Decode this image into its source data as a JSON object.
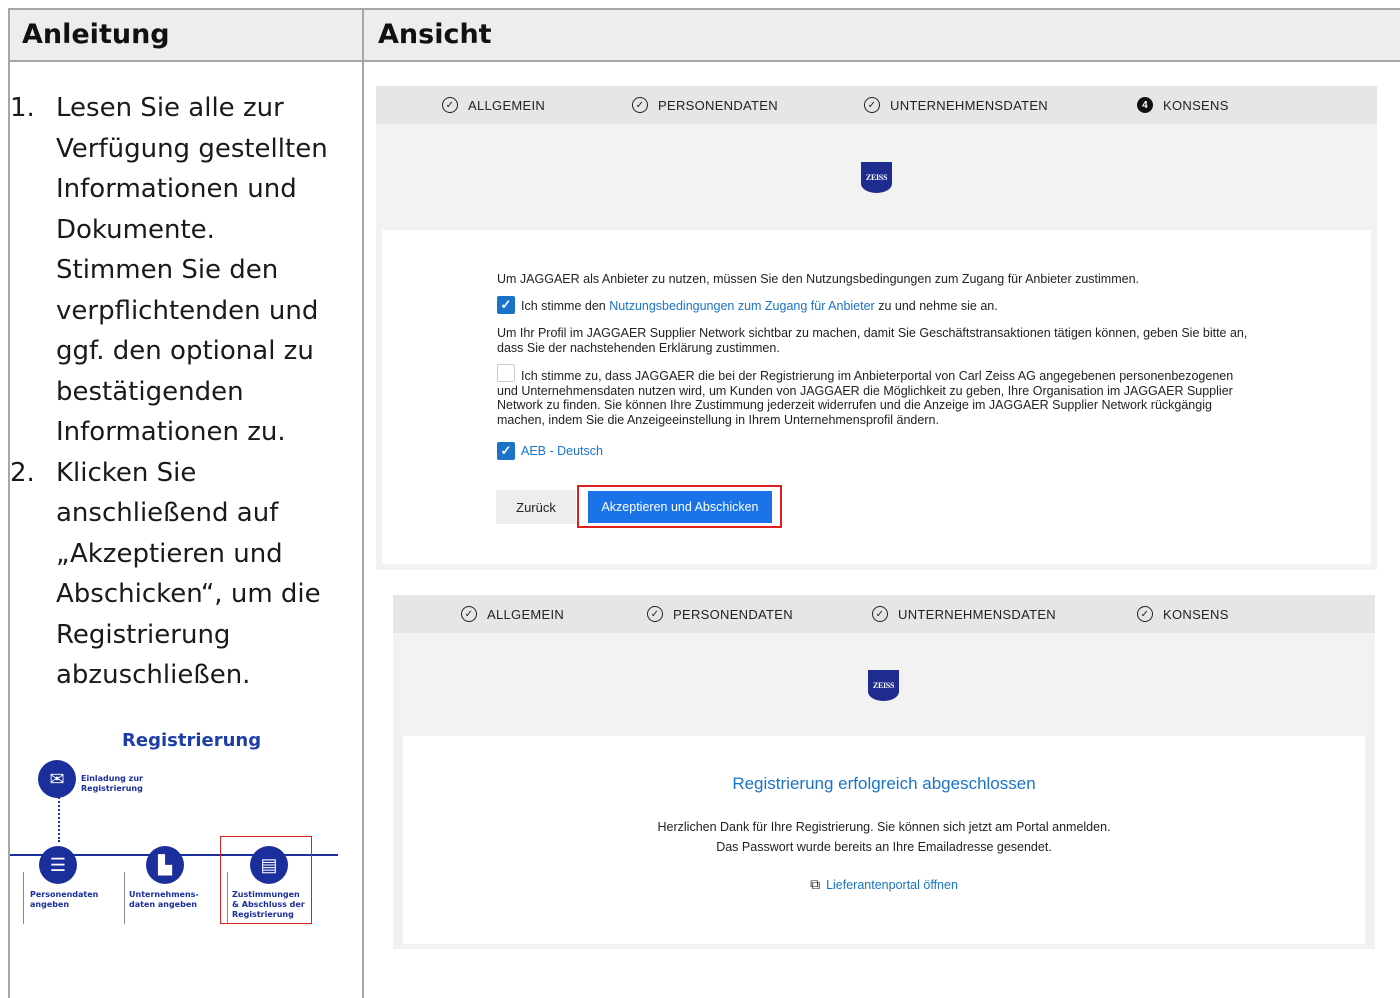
{
  "table": {
    "col_left_header": "Anleitung",
    "col_right_header": "Ansicht"
  },
  "instructions": [
    {
      "num": "1.",
      "text": "Lesen Sie alle zur Verfügung gestellten Informationen und Dokumente. Stimmen Sie den verpflichtenden und ggf. den optional zu bestätigenden Informationen zu."
    },
    {
      "num": "2.",
      "text": "Klicken Sie anschließend auf „Akzeptieren und Abschicken“, um die Registrierung abzuschließen."
    }
  ],
  "diagram": {
    "title": "Registrierung",
    "steps": [
      {
        "label": "Einladung zur Registrierung",
        "icon": "mail-icon"
      },
      {
        "label": "Personendaten angeben",
        "icon": "id-card-icon"
      },
      {
        "label": "Unternehmens-daten angeben",
        "icon": "factory-icon"
      },
      {
        "label": "Zustimmungen & Abschluss der Registrierung",
        "icon": "clipboard-icon"
      }
    ]
  },
  "screen1": {
    "steps": [
      {
        "label": "ALLGEMEIN",
        "icon": "check-circle-icon",
        "mark": "✓"
      },
      {
        "label": "PERSONENDATEN",
        "icon": "check-circle-icon",
        "mark": "✓"
      },
      {
        "label": "UNTERNEHMENSDATEN",
        "icon": "check-circle-icon",
        "mark": "✓"
      },
      {
        "label": "KONSENS",
        "icon": "step-number-icon",
        "mark": "4"
      }
    ],
    "logo_text": "ZEISS",
    "intro": "Um JAGGAER als Anbieter zu nutzen, müssen Sie den Nutzungsbedingungen zum Zugang für Anbieter zustimmen.",
    "terms_prefix": "Ich stimme den",
    "terms_link": "Nutzungsbedingungen zum Zugang für Anbieter",
    "terms_suffix": "zu und nehme sie an.",
    "profile_text": "Um Ihr Profil im JAGGAER Supplier Network sichtbar zu machen, damit Sie Geschäftstransaktionen tätigen können, geben Sie bitte an, dass Sie der nachstehenden Erklärung zustimmen.",
    "consent_text": "Ich stimme zu, dass JAGGAER die bei der Registrierung im Anbieterportal von Carl Zeiss AG angegebenen personenbezogenen und Unternehmensdaten nutzen wird, um Kunden von JAGGAER die Möglichkeit zu geben, Ihre Organisation im JAGGAER Supplier Network zu finden. Sie können Ihre Zustimmung jederzeit widerrufen und die Anzeige im JAGGAER Supplier Network rückgängig machen, indem Sie die Anzeigeeinstellung in Ihrem Unternehmensprofil ändern.",
    "aeb_link": "AEB - Deutsch",
    "back_label": "Zurück",
    "accept_label": "Akzeptieren und Abschicken",
    "checkmark": "✓",
    "colors": {
      "accent": "#1a73e8",
      "highlight": "#e02020"
    }
  },
  "screen2": {
    "steps": [
      {
        "label": "ALLGEMEIN",
        "icon": "check-circle-icon",
        "mark": "✓"
      },
      {
        "label": "PERSONENDATEN",
        "icon": "check-circle-icon",
        "mark": "✓"
      },
      {
        "label": "UNTERNEHMENSDATEN",
        "icon": "check-circle-icon",
        "mark": "✓"
      },
      {
        "label": "KONSENS",
        "icon": "check-circle-icon",
        "mark": "✓"
      }
    ],
    "logo_text": "ZEISS",
    "success_title": "Registrierung erfolgreich abgeschlossen",
    "thanks_line1": "Herzlichen Dank für Ihre Registrierung. Sie können sich jetzt am Portal anmelden.",
    "thanks_line2": "Das Passwort wurde bereits an Ihre Emailadresse gesendet.",
    "portal_link": "Lieferantenportal öffnen",
    "portal_icon": "external-link-icon"
  }
}
